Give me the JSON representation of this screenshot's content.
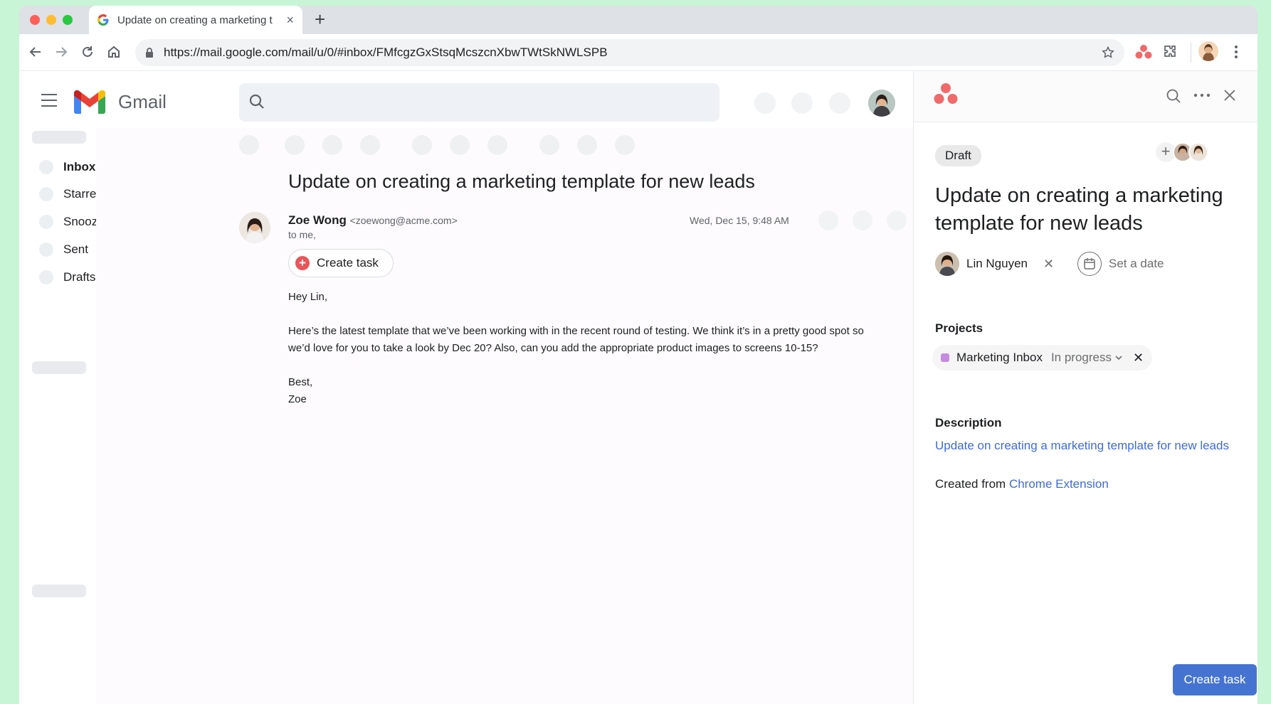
{
  "browser": {
    "tab_title": "Update on creating a marketing t",
    "tab_close": "×",
    "new_tab": "+",
    "url": "https://mail.google.com/mail/u/0/#inbox/FMfcgzGxStsqMcszcnXbwTWtSkNWLSPB"
  },
  "gmail": {
    "wordmark": "Gmail",
    "nav": [
      {
        "label": "Inbox"
      },
      {
        "label": "Starred"
      },
      {
        "label": "Snoozed"
      },
      {
        "label": "Sent"
      },
      {
        "label": "Drafts"
      }
    ],
    "message": {
      "subject": "Update on creating a marketing template for new leads",
      "sender_name": "Zoe Wong",
      "sender_email": "<zoewong@acme.com>",
      "to": "to me,",
      "date": "Wed, Dec 15, 9:48 AM",
      "create_task_label": "Create task",
      "greeting": "Hey Lin,",
      "body_line1": "Here’s the latest template that we’ve been working with in the recent round of testing. We think it’s in a pretty good spot so",
      "body_line2": "we’d love for you to take a look by Dec 20? Also, can you add the appropriate product images to screens 10-15?",
      "signoff": "Best,",
      "signature": "Zoe"
    }
  },
  "asana": {
    "status_badge": "Draft",
    "add_collaborator": "+",
    "task_title": "Update on creating a marketing template for new leads",
    "assignee": "Lin Nguyen",
    "assignee_remove": "✕",
    "set_date": "Set a date",
    "projects_label": "Projects",
    "project": {
      "name": "Marketing Inbox",
      "status": "In progress",
      "remove": "✕",
      "color": "#c58be0"
    },
    "description_label": "Description",
    "description_link": "Update on creating a marketing template for new leads",
    "created_from_prefix": "Created from ",
    "created_from_link": "Chrome Extension",
    "create_button": "Create task",
    "brand_color": "#f06a6a",
    "button_color": "#4573d2"
  }
}
